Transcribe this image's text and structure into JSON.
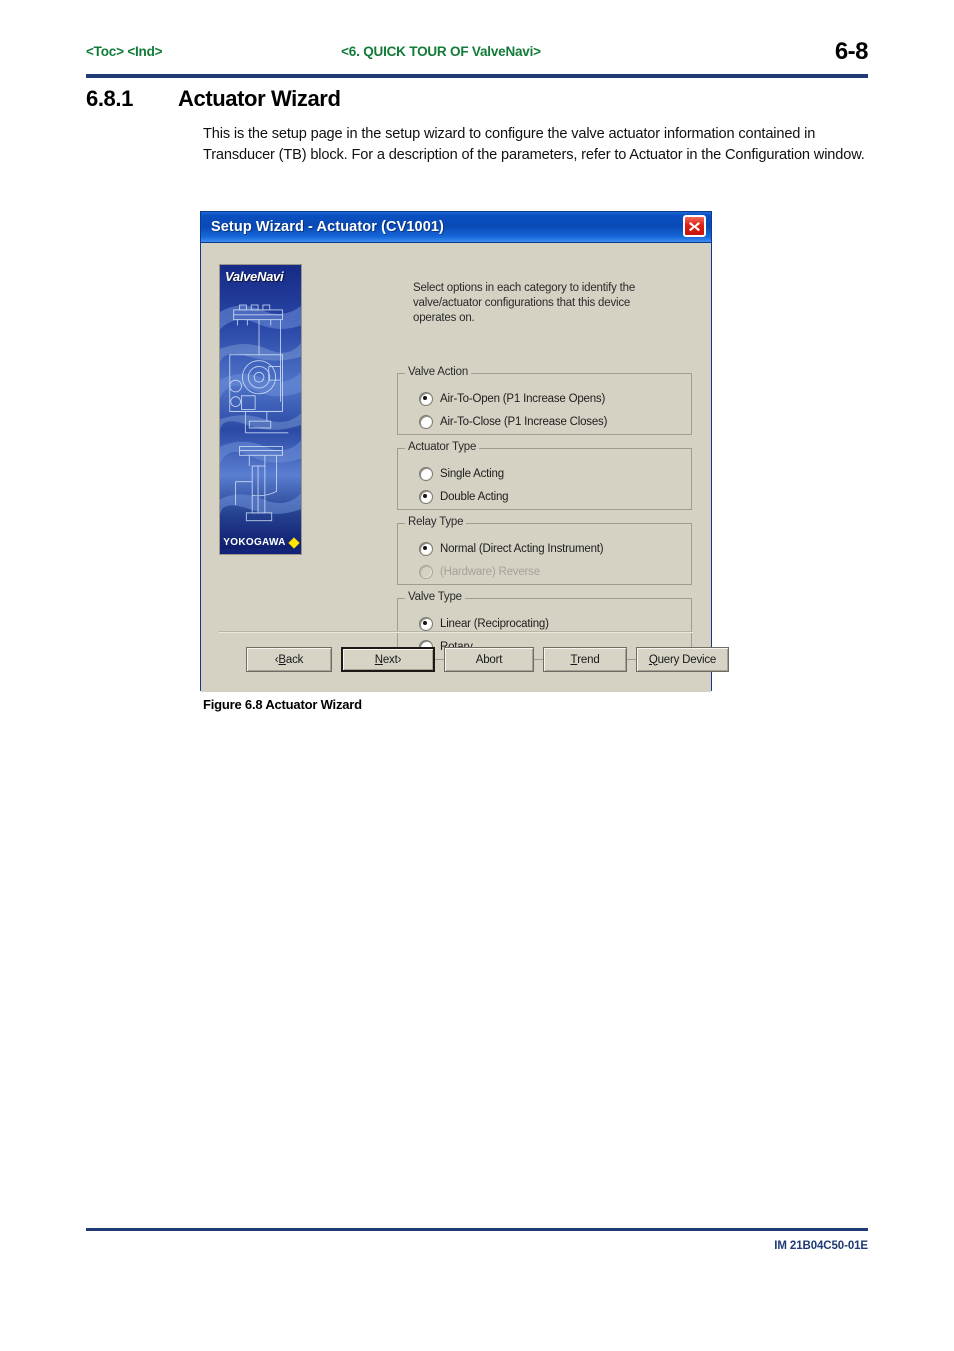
{
  "page_header": {
    "left_links": "<Toc> <Ind>",
    "center_title": "<6.  QUICK TOUR OF ValveNavi>",
    "page_number": "6-8"
  },
  "section": {
    "number": "6.8.1",
    "title": "Actuator Wizard",
    "paragraph": "This is the setup page in the setup wizard to configure the valve actuator information contained in Transducer (TB) block. For a description of the parameters, refer to Actuator in the Configuration window."
  },
  "dialog": {
    "title": "Setup Wizard - Actuator (CV1001)",
    "close_icon": "close-icon",
    "banner": {
      "product_name": "ValveNavi",
      "brand": "YOKOGAWA",
      "brand_mark": "diamond"
    },
    "instruction": "Select options in each category to identify the valve/actuator configurations that this device operates on.",
    "groups": [
      {
        "legend": "Valve Action",
        "options": [
          {
            "label": "Air-To-Open (P1 Increase Opens)",
            "selected": true,
            "disabled": false
          },
          {
            "label": "Air-To-Close (P1 Increase Closes)",
            "selected": false,
            "disabled": false
          }
        ]
      },
      {
        "legend": "Actuator Type",
        "options": [
          {
            "label": "Single Acting",
            "selected": false,
            "disabled": false
          },
          {
            "label": "Double Acting",
            "selected": true,
            "disabled": false
          }
        ]
      },
      {
        "legend": "Relay Type",
        "options": [
          {
            "label": "Normal (Direct Acting Instrument)",
            "selected": true,
            "disabled": false
          },
          {
            "label": "(Hardware) Reverse",
            "selected": false,
            "disabled": true
          }
        ]
      },
      {
        "legend": "Valve Type",
        "options": [
          {
            "label": "Linear (Reciprocating)",
            "selected": true,
            "disabled": false
          },
          {
            "label": "Rotary",
            "selected": false,
            "disabled": false
          }
        ]
      }
    ],
    "buttons": [
      {
        "prefix": "‹ ",
        "accel": "B",
        "rest": "ack",
        "suffix": "",
        "default": false
      },
      {
        "prefix": "",
        "accel": "N",
        "rest": "ext",
        "suffix": " ›",
        "default": true
      },
      {
        "prefix": "",
        "accel": "",
        "rest": "Abort",
        "suffix": "",
        "default": false
      },
      {
        "prefix": "",
        "accel": "T",
        "rest": "rend",
        "suffix": "",
        "default": false
      },
      {
        "prefix": "",
        "accel": "Q",
        "rest": "uery Device",
        "suffix": "",
        "default": false
      }
    ]
  },
  "figure_caption": "Figure 6.8 Actuator Wizard",
  "footer": {
    "document_code": "IM 21B04C50-01E"
  },
  "colors": {
    "header_green": "#127b38",
    "rule_navy": "#1f3a74",
    "titlebar_blue": "#0a4fc0",
    "dialog_face": "#d5d2c4",
    "close_red": "#dd2216",
    "banner_blue": "#13237a",
    "brand_yellow": "#ffe500"
  }
}
